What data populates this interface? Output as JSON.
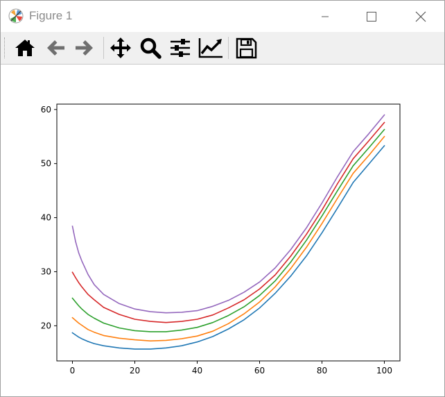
{
  "window": {
    "title": "Figure 1",
    "app_icon": "matplotlib-logo-icon",
    "controls": [
      "minimize-icon",
      "maximize-icon",
      "close-icon"
    ]
  },
  "toolbar": {
    "buttons": [
      {
        "name": "home",
        "icon": "home-icon",
        "tooltip": "Reset original view"
      },
      {
        "name": "back",
        "icon": "arrow-left-icon",
        "tooltip": "Back to previous view"
      },
      {
        "name": "forward",
        "icon": "arrow-right-icon",
        "tooltip": "Forward to next view"
      },
      {
        "name": "pan",
        "icon": "move-icon",
        "tooltip": "Pan axes"
      },
      {
        "name": "zoom",
        "icon": "magnifier-icon",
        "tooltip": "Zoom to rectangle"
      },
      {
        "name": "subplots",
        "icon": "sliders-icon",
        "tooltip": "Configure subplots"
      },
      {
        "name": "customize",
        "icon": "chart-line-icon",
        "tooltip": "Edit axis, curve and image parameters"
      },
      {
        "name": "save",
        "icon": "floppy-disk-icon",
        "tooltip": "Save the figure"
      }
    ]
  },
  "colors": {
    "series": [
      "#1f77b4",
      "#ff7f0e",
      "#2ca02c",
      "#d62728",
      "#9467bd"
    ],
    "toolbar_bg": "#f0f0f0",
    "disabled_icon": "#6f6f6f"
  },
  "chart_data": {
    "type": "line",
    "title": "",
    "xlabel": "",
    "ylabel": "",
    "xlim": [
      -5,
      105
    ],
    "ylim": [
      13.5,
      61
    ],
    "xticks": [
      0,
      20,
      40,
      60,
      80,
      100
    ],
    "yticks": [
      20,
      30,
      40,
      50,
      60
    ],
    "grid": false,
    "legend": "none",
    "x": [
      0,
      1,
      2,
      3,
      5,
      7,
      10,
      15,
      20,
      25,
      30,
      35,
      40,
      45,
      50,
      55,
      60,
      65,
      70,
      75,
      80,
      85,
      90,
      95,
      100
    ],
    "series": [
      {
        "color": "#1f77b4",
        "values": [
          18.7,
          18.3,
          17.9,
          17.6,
          17.1,
          16.7,
          16.3,
          15.9,
          15.7,
          15.7,
          15.9,
          16.3,
          17.0,
          18.0,
          19.4,
          21.1,
          23.3,
          26.0,
          29.2,
          32.9,
          37.2,
          41.8,
          46.5,
          49.9,
          53.3
        ]
      },
      {
        "color": "#ff7f0e",
        "values": [
          21.5,
          21.0,
          20.5,
          20.1,
          19.3,
          18.8,
          18.2,
          17.7,
          17.4,
          17.2,
          17.3,
          17.6,
          18.1,
          19.0,
          20.4,
          22.2,
          24.4,
          27.2,
          30.6,
          34.5,
          38.9,
          43.6,
          48.2,
          51.5,
          55.0
        ]
      },
      {
        "color": "#2ca02c",
        "values": [
          25.1,
          24.4,
          23.7,
          23.1,
          22.1,
          21.4,
          20.5,
          19.6,
          19.1,
          18.9,
          18.9,
          19.2,
          19.7,
          20.6,
          21.9,
          23.5,
          25.6,
          28.3,
          31.8,
          35.8,
          40.3,
          45.0,
          49.6,
          52.9,
          56.3
        ]
      },
      {
        "color": "#d62728",
        "values": [
          29.9,
          28.9,
          28.0,
          27.2,
          25.8,
          24.8,
          23.4,
          22.1,
          21.2,
          20.8,
          20.6,
          20.8,
          21.2,
          22.0,
          23.3,
          24.8,
          26.8,
          29.4,
          32.9,
          36.9,
          41.4,
          46.3,
          50.9,
          54.2,
          57.6
        ]
      },
      {
        "color": "#9467bd",
        "values": [
          38.4,
          35.6,
          33.5,
          32.0,
          29.5,
          27.6,
          25.8,
          24.1,
          23.1,
          22.6,
          22.4,
          22.5,
          22.8,
          23.6,
          24.7,
          26.2,
          28.1,
          30.7,
          34.1,
          38.1,
          42.7,
          47.6,
          52.2,
          55.5,
          59.0
        ]
      }
    ]
  }
}
